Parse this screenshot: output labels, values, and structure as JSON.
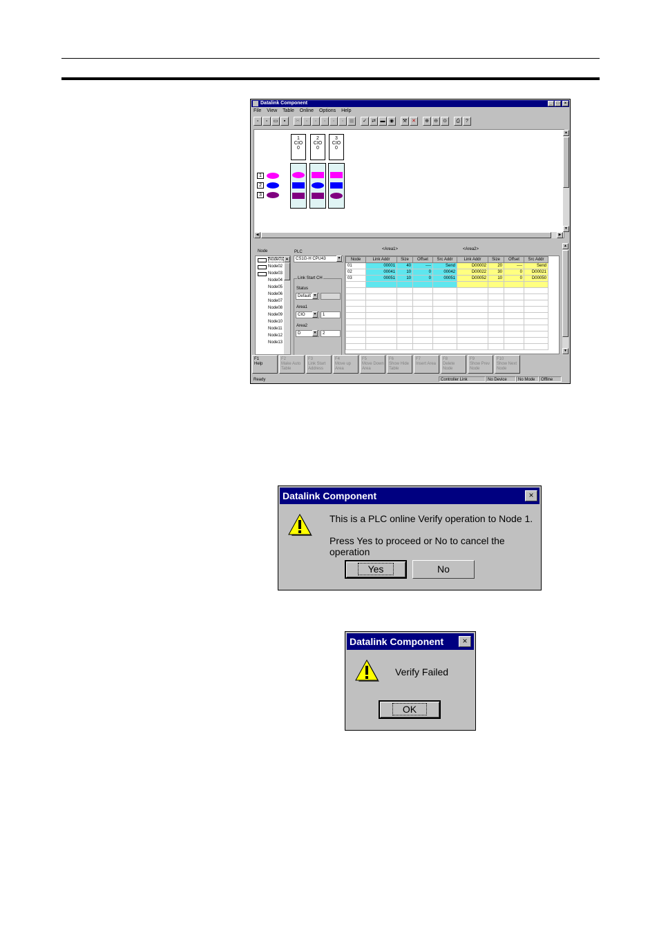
{
  "main_window": {
    "title": "Datalink Component",
    "menu": [
      "File",
      "View",
      "Table",
      "Online",
      "Options",
      "Help"
    ],
    "nodes": [
      {
        "num": "1",
        "area": "CIO",
        "value": "0"
      },
      {
        "num": "2",
        "area": "CIO",
        "value": "0"
      },
      {
        "num": "3",
        "area": "CIO",
        "value": "0"
      }
    ],
    "legend": [
      "1",
      "2",
      "3"
    ],
    "colors": {
      "magenta": "#ff00ff",
      "blue": "#0000ff",
      "purple": "#800080",
      "cyan": "#5ee6ee",
      "yellow": "#ffff80",
      "titlebar": "#000080"
    },
    "node_list_header": "Node",
    "node_list": [
      "Node01",
      "Node02",
      "Node03",
      "Node04",
      "Node05",
      "Node06",
      "Node07",
      "Node08",
      "Node09",
      "Node10",
      "Node11",
      "Node12",
      "Node13"
    ],
    "plc_label": "PLC",
    "plc_value": "CS1G-H CPU43",
    "link_start_label": "Link Start CH",
    "status_label": "Status",
    "status_value": "Default",
    "area1_label": "Area1",
    "area1_type": "CIO",
    "area1_value": "1",
    "area2_label": "Area2",
    "area2_type": "D",
    "area2_value": "2",
    "grid": {
      "area1_header": "<Area1>",
      "area2_header": "<Area2>",
      "columns": [
        "Node",
        "Link Addr",
        "Size",
        "Offset",
        "Src Addr",
        "Link Addr",
        "Size",
        "Offset",
        "Src Addr"
      ],
      "rows": [
        [
          "01",
          "00001",
          "40",
          "----",
          "Send",
          "D00002",
          "20",
          "----",
          "Send"
        ],
        [
          "02",
          "00041",
          "10",
          "0",
          "00042",
          "D00022",
          "30",
          "0",
          "D00021"
        ],
        [
          "03",
          "00051",
          "10",
          "0",
          "00051",
          "D00052",
          "10",
          "0",
          "D00050"
        ]
      ]
    },
    "fkeys": [
      {
        "key": "F1",
        "label": "Help"
      },
      {
        "key": "F2",
        "label": "Make Auto Table"
      },
      {
        "key": "F3",
        "label": "Link Start Address"
      },
      {
        "key": "F4",
        "label": "Move up Area"
      },
      {
        "key": "F5",
        "label": "Move Down Area"
      },
      {
        "key": "F6",
        "label": "Show Hide Table"
      },
      {
        "key": "F7",
        "label": "Insert Area"
      },
      {
        "key": "F8",
        "label": "Delete Node"
      },
      {
        "key": "F9",
        "label": "Show Prev Node"
      },
      {
        "key": "F10",
        "label": "Show Next Node"
      }
    ],
    "status": {
      "ready": "Ready",
      "network": "Controller Link",
      "device": "No Device",
      "mode": "No Mode",
      "connection": "Offline"
    }
  },
  "dialog1": {
    "title": "Datalink Component",
    "close": "×",
    "line1": "This is a PLC online Verify operation to Node 1.",
    "line2": "Press Yes to proceed or No to cancel the operation",
    "yes": "Yes",
    "no": "No"
  },
  "dialog2": {
    "title": "Datalink Component",
    "close": "×",
    "message": "Verify Failed",
    "ok": "OK"
  }
}
